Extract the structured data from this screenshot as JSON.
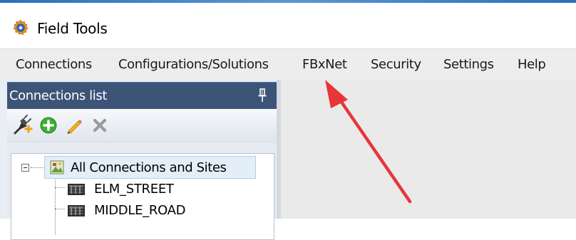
{
  "window": {
    "title": "Field Tools",
    "icon": "gear-app-icon"
  },
  "menubar": {
    "items": [
      {
        "label": "Connections"
      },
      {
        "label": "Configurations/Solutions"
      },
      {
        "label": "FBxNet"
      },
      {
        "label": "Security"
      },
      {
        "label": "Settings"
      },
      {
        "label": "Help"
      }
    ]
  },
  "connections_panel": {
    "title": "Connections list",
    "pin_icon": "pin-icon",
    "toolbar": [
      {
        "icon": "connect-plug-icon"
      },
      {
        "icon": "add-icon"
      },
      {
        "icon": "edit-pencil-icon"
      },
      {
        "icon": "delete-x-icon"
      }
    ],
    "tree": {
      "root": {
        "label": "All Connections and Sites",
        "icon": "sites-icon",
        "expanded": true
      },
      "children": [
        {
          "label": "ELM_STREET",
          "icon": "device-icon"
        },
        {
          "label": "MIDDLE_ROAD",
          "icon": "device-icon"
        }
      ]
    }
  },
  "annotation": {
    "type": "arrow",
    "color": "#e8353a",
    "points_to": "FBxNet"
  }
}
